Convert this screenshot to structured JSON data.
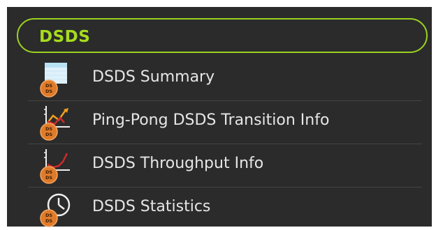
{
  "header": {
    "title": "DSDS"
  },
  "items": [
    {
      "label": "DSDS Summary",
      "icon": "summary-table-icon"
    },
    {
      "label": "Ping-Pong DSDS Transition Info",
      "icon": "transition-chart-icon"
    },
    {
      "label": "DSDS Throughput Info",
      "icon": "throughput-chart-icon"
    },
    {
      "label": "DSDS Statistics",
      "icon": "statistics-clock-icon"
    }
  ],
  "badge_text": {
    "top": "DS",
    "bottom": "DS"
  },
  "colors": {
    "accent": "#9bd21f",
    "background": "#2b2b2b",
    "badge": "#e07b2a",
    "text": "#e6e6e6"
  }
}
